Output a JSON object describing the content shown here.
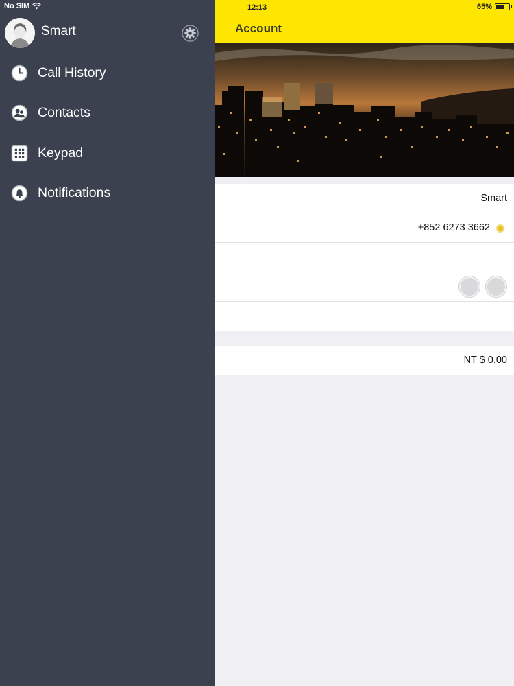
{
  "status_bar": {
    "carrier": "No SIM",
    "time": "12:13",
    "battery": "65%",
    "battery_level": 0.65
  },
  "sidebar": {
    "profile_name": "Smart",
    "items": [
      {
        "label": "Call History",
        "icon": "clock-icon"
      },
      {
        "label": "Contacts",
        "icon": "contacts-icon"
      },
      {
        "label": "Keypad",
        "icon": "keypad-icon"
      },
      {
        "label": "Notifications",
        "icon": "bell-icon"
      }
    ]
  },
  "header": {
    "title": "Account"
  },
  "account": {
    "name": "Smart",
    "phone": "+852 6273 3662",
    "balance": "NT $ 0.00"
  },
  "colors": {
    "accent": "#ffe600",
    "sidebar_bg": "#3b414f",
    "verified": "#e8c32a"
  }
}
